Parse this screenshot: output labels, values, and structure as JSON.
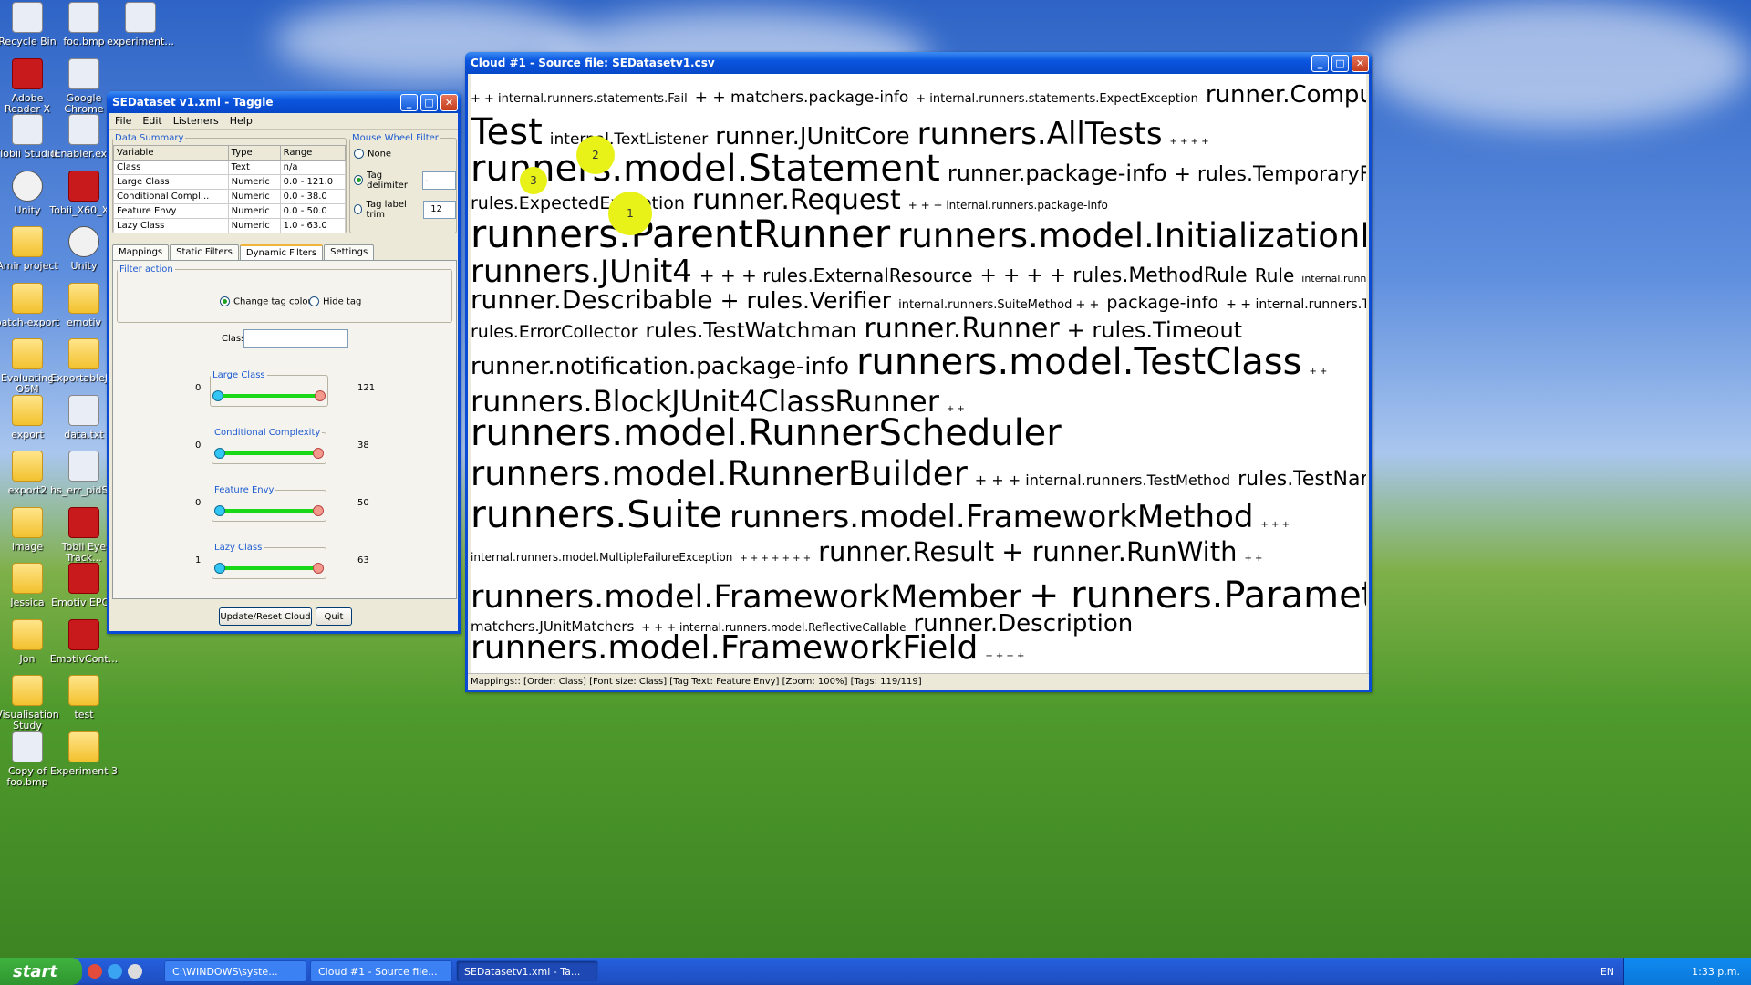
{
  "desktop": {
    "icons_col1": [
      "Recycle Bin",
      "Adobe Reader X",
      "Tobii Studio",
      "Unity",
      "Amir project",
      "batch-export",
      "Evaluating OSM",
      "export",
      "export2",
      "image",
      "Jessica",
      "Jon",
      "Visualisation Study",
      "Copy of foo.bmp"
    ],
    "icons_col2": [
      "foo.bmp",
      "Google Chrome",
      "IEnabler.ex...",
      "Tobii_X60_X...",
      "Unity",
      "emotiv",
      "ExportableJ...",
      "data.txt",
      "hs_err_pidS...",
      "Tobii Eye Track...",
      "Emotiv EPOC",
      "EmotivCont...",
      "test",
      "Experiment 3"
    ],
    "icons_col3": [
      "experiment..."
    ]
  },
  "taggle": {
    "title": "SEDataset v1.xml - Taggle",
    "menu": [
      "File",
      "Edit",
      "Listeners",
      "Help"
    ],
    "data_summary_legend": "Data Summary",
    "table_headers": [
      "Variable",
      "Type",
      "Range"
    ],
    "rows": [
      [
        "Class",
        "Text",
        "n/a"
      ],
      [
        "Large Class",
        "Numeric",
        "0.0 - 121.0"
      ],
      [
        "Conditional Compl...",
        "Numeric",
        "0.0 - 38.0"
      ],
      [
        "Feature Envy",
        "Numeric",
        "0.0 - 50.0"
      ],
      [
        "Lazy Class",
        "Numeric",
        "1.0 - 63.0"
      ]
    ],
    "mouse_wheel_legend": "Mouse Wheel Filter",
    "mw_none": "None",
    "mw_tag_delimiter": "Tag delimiter",
    "mw_tag_delimiter_value": ".",
    "mw_tag_label_trim": "Tag label trim",
    "mw_tag_label_trim_value": "12",
    "tabs": [
      "Mappings",
      "Static Filters",
      "Dynamic Filters",
      "Settings"
    ],
    "filter_action_legend": "Filter action",
    "opt_change_colour": "Change tag colour",
    "opt_hide": "Hide tag",
    "class_label": "Class",
    "sliders": [
      {
        "name": "Large Class",
        "min": "0",
        "max": "121"
      },
      {
        "name": "Conditional Complexity",
        "min": "0",
        "max": "38"
      },
      {
        "name": "Feature Envy",
        "min": "0",
        "max": "50"
      },
      {
        "name": "Lazy Class",
        "min": "1",
        "max": "63"
      }
    ],
    "btn_update": "Update/Reset Cloud",
    "btn_quit": "Quit"
  },
  "cloud": {
    "title": "Cloud #1 - Source file: SEDatasetv1.csv",
    "status": "Mappings:: [Order: Class] [Font size: Class] [Tag Text: Feature Envy] [Zoom: 100%] [Tags: 119/119]",
    "bubbles": [
      "1",
      "2",
      "3"
    ]
  },
  "taskbar": {
    "start": "start",
    "items": [
      "C:\\WINDOWS\\syste...",
      "Cloud #1 - Source file...",
      "SEDatasetv1.xml - Ta..."
    ],
    "lang": "EN",
    "time": "1:33 p.m."
  }
}
